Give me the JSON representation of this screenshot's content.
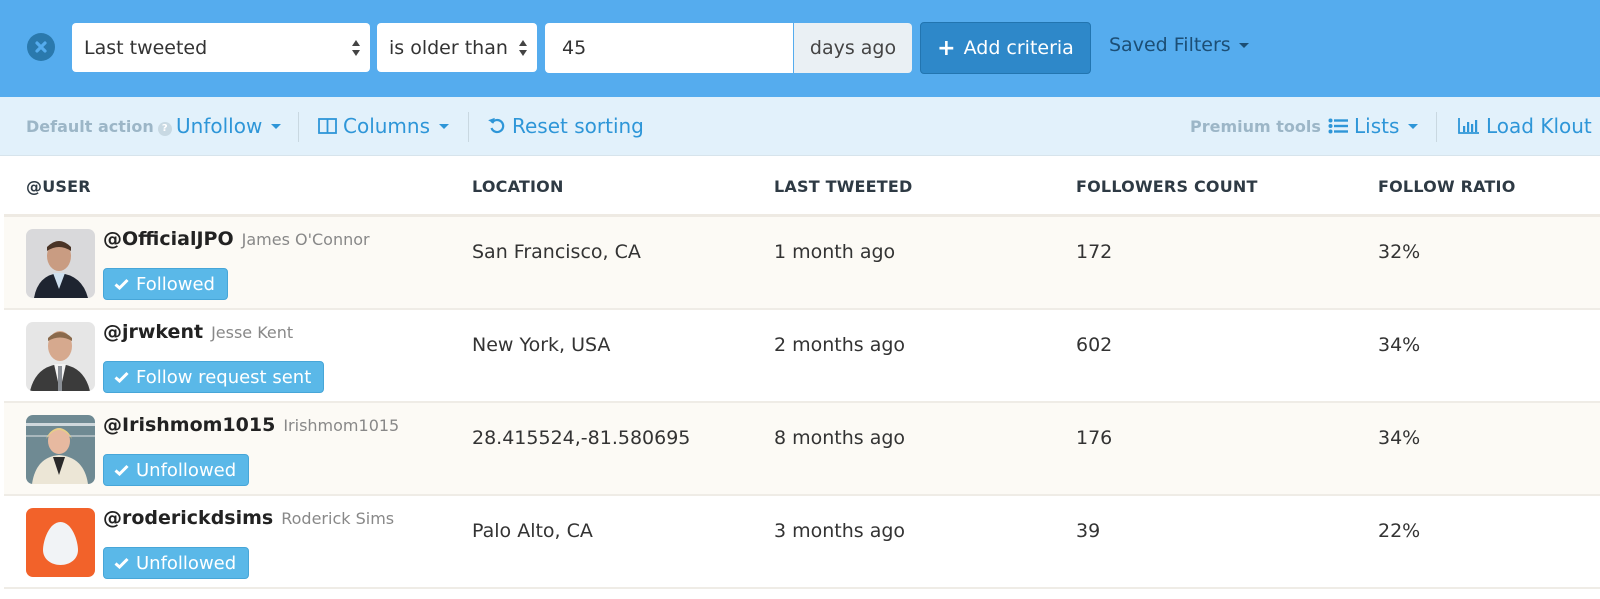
{
  "filter": {
    "field_select": "Last tweeted",
    "operator_select": "is older than",
    "value": "45",
    "unit_addon": "days ago",
    "add_criteria_label": "Add criteria",
    "saved_filters_label": "Saved Filters"
  },
  "toolbar": {
    "default_action_label": "Default action",
    "default_action_value": "Unfollow",
    "columns_label": "Columns",
    "reset_sorting_label": "Reset sorting",
    "premium_tools_label": "Premium tools",
    "lists_label": "Lists",
    "load_klout_label": "Load Klout"
  },
  "table": {
    "columns": [
      "@USER",
      "LOCATION",
      "LAST TWEETED",
      "FOLLOWERS COUNT",
      "FOLLOW RATIO"
    ],
    "rows": [
      {
        "handle": "@OfficialJPO",
        "name": "James O'Connor",
        "status": "Followed",
        "location": "San Francisco, CA",
        "last_tweeted": "1 month ago",
        "followers": "172",
        "ratio": "32%"
      },
      {
        "handle": "@jrwkent",
        "name": "Jesse Kent",
        "status": "Follow request sent",
        "location": "New York, USA",
        "last_tweeted": "2 months ago",
        "followers": "602",
        "ratio": "34%"
      },
      {
        "handle": "@Irishmom1015",
        "name": "Irishmom1015",
        "status": "Unfollowed",
        "location": "28.415524,-81.580695",
        "last_tweeted": "8 months ago",
        "followers": "176",
        "ratio": "34%"
      },
      {
        "handle": "@roderickdsims",
        "name": "Roderick Sims",
        "status": "Unfollowed",
        "location": "Palo Alto, CA",
        "last_tweeted": "3 months ago",
        "followers": "39",
        "ratio": "22%"
      }
    ]
  },
  "colors": {
    "filter_bar": "#55acee",
    "toolbar": "#e2f1fb",
    "accent": "#2e96d8",
    "status_badge": "#5ab8e8",
    "egg_avatar": "#f2622a"
  }
}
